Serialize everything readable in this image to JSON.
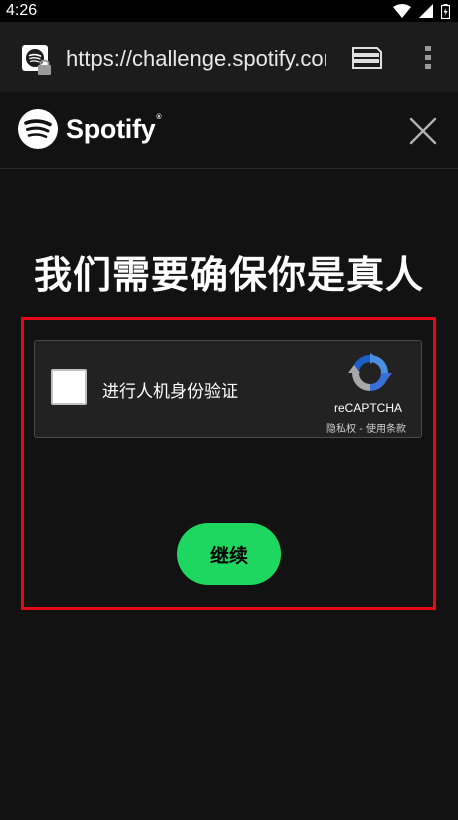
{
  "status_bar": {
    "time": "4:26",
    "icons": [
      "wifi-icon",
      "cell-signal-icon",
      "battery-icon"
    ]
  },
  "browser": {
    "url": "https://challenge.spotify.com",
    "site_icon": "spotify-lock-icon",
    "tabs_icon": "tabs-icon",
    "menu_icon": "more-vert-icon"
  },
  "header": {
    "brand": "Spotify",
    "trademark": "®",
    "close_icon": "close-icon"
  },
  "main": {
    "heading": "我们需要确保你是真人"
  },
  "recaptcha": {
    "label": "进行人机身份验证",
    "brand": "reCAPTCHA",
    "privacy": "隐私权",
    "separator": " - ",
    "terms": "使用条款"
  },
  "actions": {
    "continue_label": "继续"
  },
  "colors": {
    "accent": "#1ed760",
    "highlight_border": "#e50914",
    "background": "#121212"
  }
}
